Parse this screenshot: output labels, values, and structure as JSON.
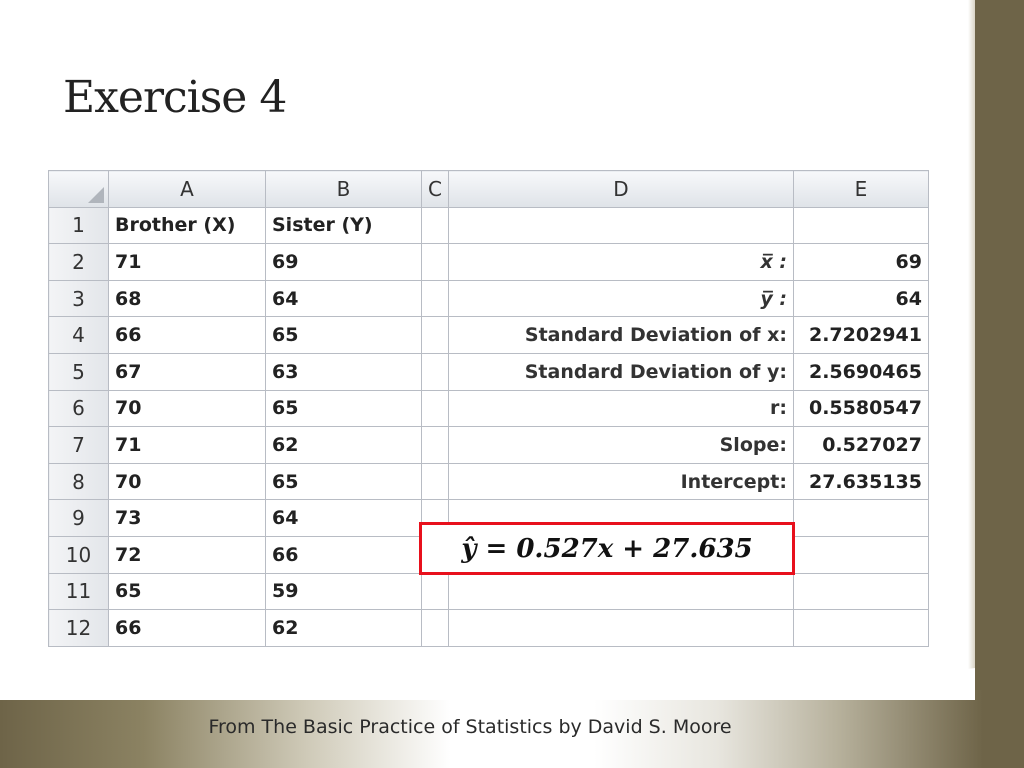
{
  "slide": {
    "title": "Exercise 4",
    "footer": "From The Basic Practice of Statistics by David S. Moore"
  },
  "sheet": {
    "columns": [
      "A",
      "B",
      "C",
      "D",
      "E"
    ],
    "rows": [
      {
        "n": "1",
        "a": "Brother (X)",
        "b": "Sister (Y)",
        "d": "",
        "e": ""
      },
      {
        "n": "2",
        "a": "71",
        "b": "69",
        "d": "x̅ :",
        "e": "69"
      },
      {
        "n": "3",
        "a": "68",
        "b": "64",
        "d": "y̅ :",
        "e": "64"
      },
      {
        "n": "4",
        "a": "66",
        "b": "65",
        "d": "Standard Deviation of x:",
        "e": "2.7202941"
      },
      {
        "n": "5",
        "a": "67",
        "b": "63",
        "d": "Standard Deviation of y:",
        "e": "2.5690465"
      },
      {
        "n": "6",
        "a": "70",
        "b": "65",
        "d": "r:",
        "e": "0.5580547"
      },
      {
        "n": "7",
        "a": "71",
        "b": "62",
        "d": "Slope:",
        "e": "0.527027"
      },
      {
        "n": "8",
        "a": "70",
        "b": "65",
        "d": "Intercept:",
        "e": "27.635135"
      },
      {
        "n": "9",
        "a": "73",
        "b": "64",
        "d": "",
        "e": ""
      },
      {
        "n": "10",
        "a": "72",
        "b": "66",
        "d": "",
        "e": ""
      },
      {
        "n": "11",
        "a": "65",
        "b": "59",
        "d": "",
        "e": ""
      },
      {
        "n": "12",
        "a": "66",
        "b": "62",
        "d": "",
        "e": ""
      }
    ]
  },
  "equation": {
    "text": "ŷ = 0.527x + 27.635"
  }
}
